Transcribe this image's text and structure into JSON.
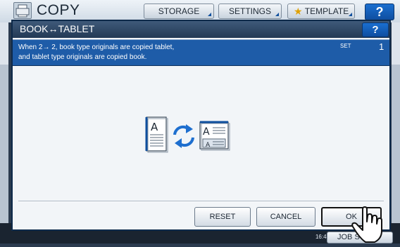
{
  "topbar": {
    "title": "COPY",
    "storage_label": "STORAGE",
    "settings_label": "SETTINGS",
    "template_label": "TEMPLATE",
    "help_label": "?",
    "icons": {
      "app": "copier-icon",
      "template": "star-icon"
    }
  },
  "dialog": {
    "title": "BOOK↔TABLET",
    "help_label": "?",
    "info_text": "When 2→ 2, book type originals are copied tablet,\nand tablet type originals are copied book.",
    "set_label": "SET",
    "set_count": "1",
    "illustration": [
      "book-page-icon",
      "swap-arrows-icon",
      "tablet-page-icon"
    ],
    "buttons": {
      "reset": "RESET",
      "cancel": "CANCEL",
      "ok": "OK"
    }
  },
  "footer": {
    "time": "16:45",
    "job_status_label": "JOB S"
  },
  "colors": {
    "header": "#2f4a69",
    "info_bar": "#1e5ca8",
    "help_button": "#1565c8",
    "panel": "#f2f5f8"
  }
}
